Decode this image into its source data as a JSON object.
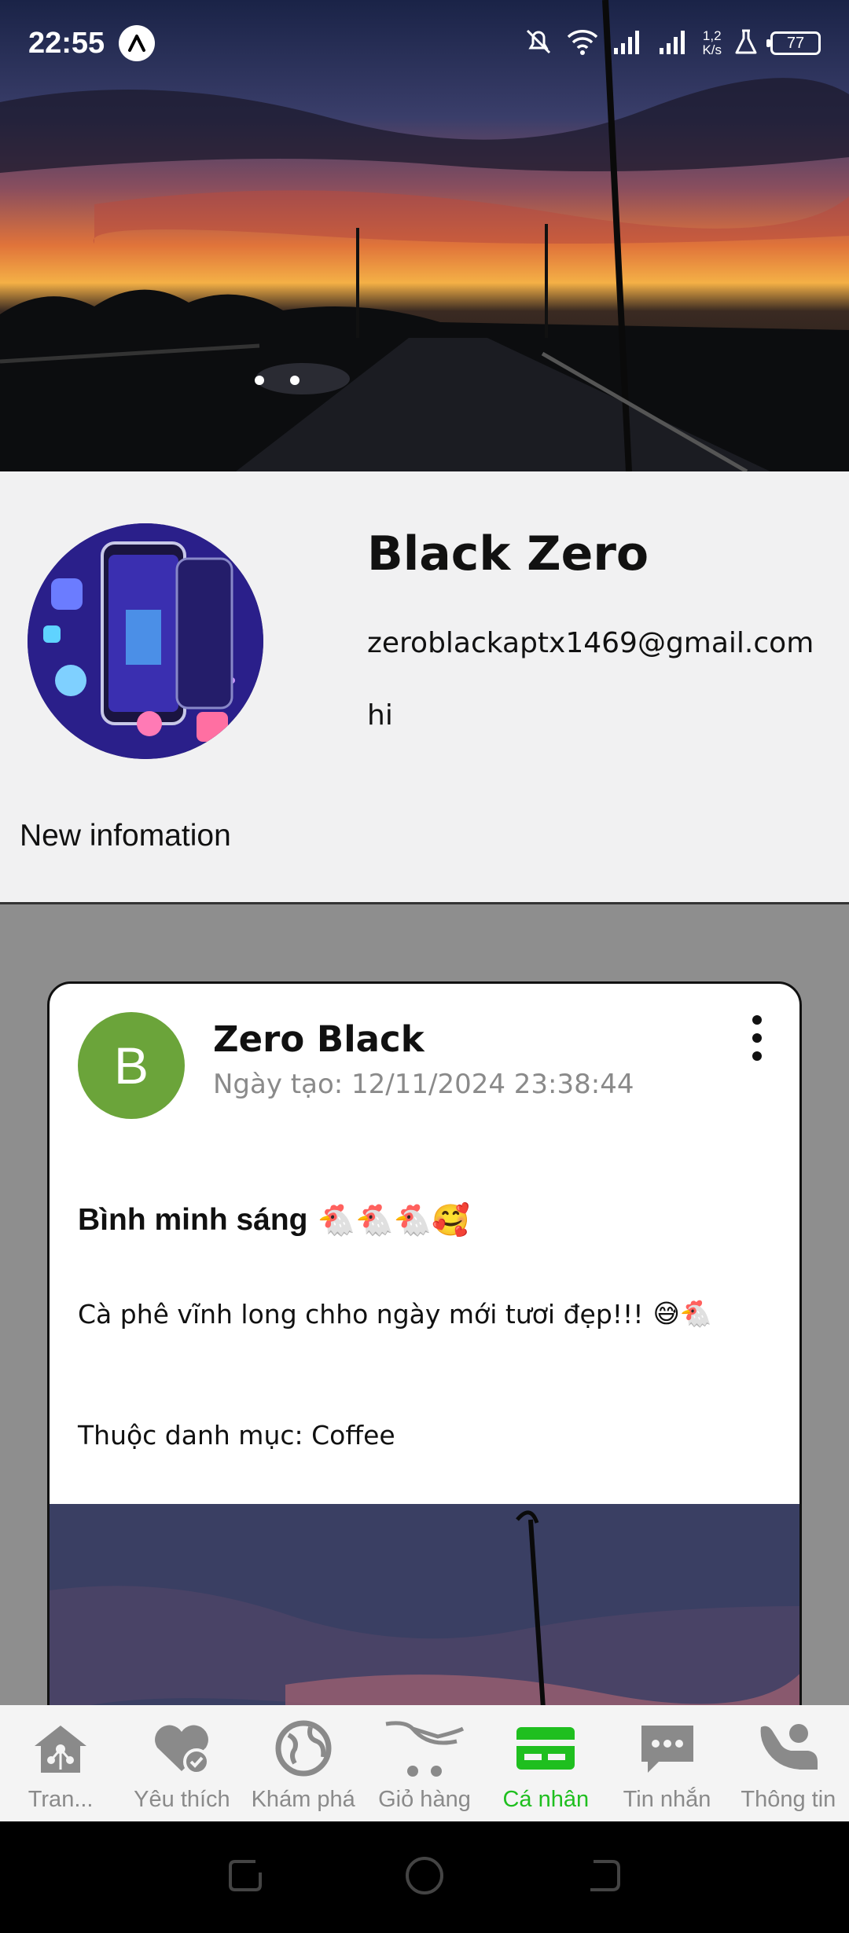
{
  "status_bar": {
    "time": "22:55",
    "net_speed_top": "1,2",
    "net_speed_bottom": "K/s",
    "battery": "77"
  },
  "profile": {
    "name": "Black Zero",
    "email": "zeroblackaptx1469@gmail.com",
    "bio": "hi",
    "new_info_label": "New infomation"
  },
  "post": {
    "avatar_letter": "B",
    "author": "Zero Black",
    "date": "Ngày tạo: 12/11/2024 23:38:44",
    "title": "Bình minh sáng",
    "title_emoji": "🐔🐔🐔🥰",
    "body": "Cà phê vĩnh long chho ngày mới tươi đẹp!!!",
    "body_emoji": "😅🐔",
    "category": "Thuộc danh mục: Coffee"
  },
  "bottom_nav": {
    "items": [
      {
        "label": "Tran...",
        "icon": "home-icon"
      },
      {
        "label": "Yêu thích",
        "icon": "heart-check-icon"
      },
      {
        "label": "Khám phá",
        "icon": "globe-icon"
      },
      {
        "label": "Giỏ hàng",
        "icon": "cart-icon"
      },
      {
        "label": "Cá nhân",
        "icon": "card-icon"
      },
      {
        "label": "Tin nhắn",
        "icon": "chat-icon"
      },
      {
        "label": "Thông tin",
        "icon": "contact-icon"
      }
    ],
    "active_index": 4,
    "active_color": "#1fbf1f",
    "inactive_color": "#8a8a8a"
  },
  "colors": {
    "post_avatar_bg": "#6ba43a",
    "feed_bg": "#8e8e8e",
    "profile_bg": "#f1f1f2"
  }
}
